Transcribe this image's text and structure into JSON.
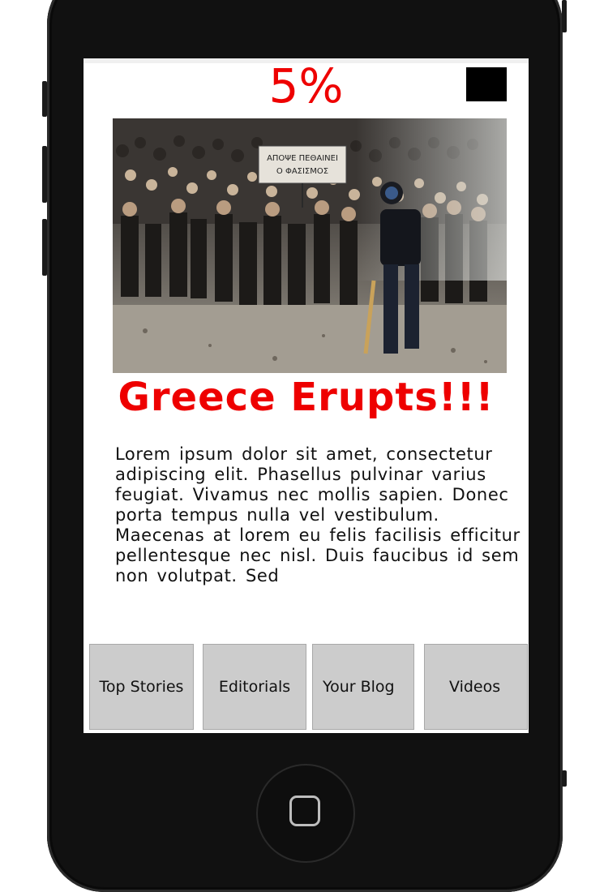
{
  "status": {
    "percent": "5%"
  },
  "article": {
    "headline": "Greece Erupts!!!",
    "image_alt": "Protest crowd in the street",
    "sign_text_line1": "ΑΠΟΨΕ ΠΕΘΑΙΝΕΙ",
    "sign_text_line2": "Ο ΦΑΣΙΣΜΟΣ",
    "body": "Lorem ipsum dolor sit amet, consectetur adipiscing elit. Phasellus pulvinar varius feugiat. Vivamus nec mollis sapien. Donec porta tempus nulla vel vestibulum. Maecenas at lorem eu felis facilisis efficitur pellentesque nec nisl. Duis faucibus id sem non volutpat. Sed"
  },
  "nav": {
    "tabs": [
      {
        "label": "Top Stories"
      },
      {
        "label": "Editorials"
      },
      {
        "label": "Your Blog"
      },
      {
        "label": "Videos"
      }
    ]
  },
  "colors": {
    "accent": "#ee0000",
    "tab_bg": "#cccccc",
    "phone": "#111111"
  }
}
